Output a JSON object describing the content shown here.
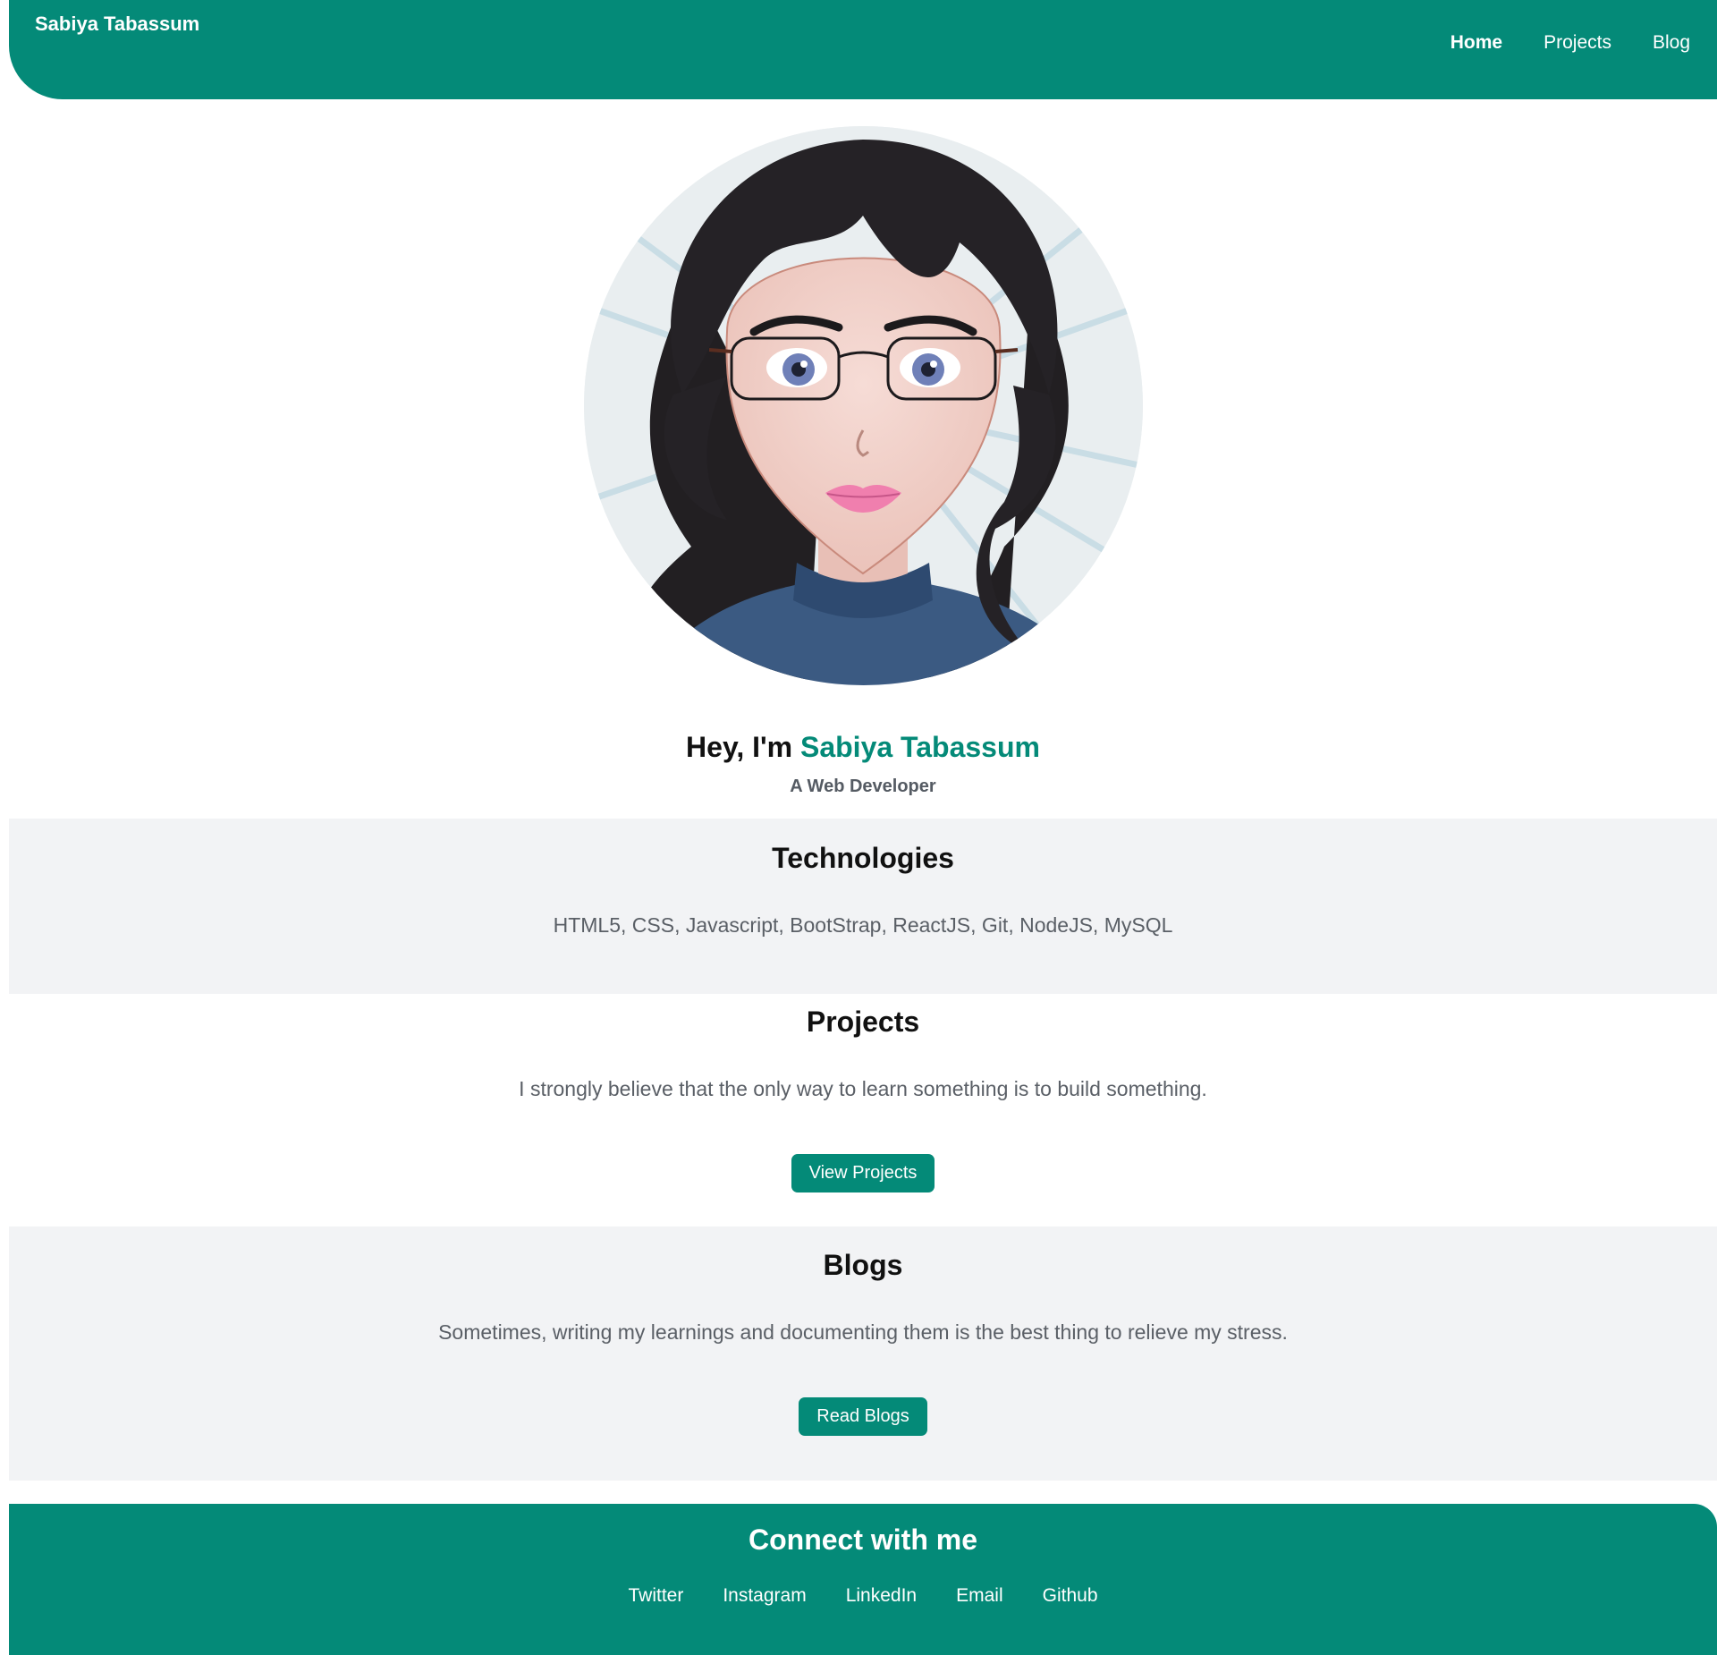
{
  "header": {
    "brand": "Sabiya Tabassum",
    "nav": [
      {
        "label": "Home",
        "active": true
      },
      {
        "label": "Projects",
        "active": false
      },
      {
        "label": "Blog",
        "active": false
      }
    ]
  },
  "hero": {
    "greeting": "Hey, I'm",
    "name": "Sabiya Tabassum",
    "subtitle": "A Web Developer"
  },
  "technologies": {
    "title": "Technologies",
    "text": "HTML5, CSS, Javascript, BootStrap, ReactJS, Git, NodeJS, MySQL"
  },
  "projects": {
    "title": "Projects",
    "text": "I strongly believe that the only way to learn something is to build something.",
    "button": "View Projects"
  },
  "blogs": {
    "title": "Blogs",
    "text": "Sometimes, writing my learnings and documenting them is the best thing to relieve my stress.",
    "button": "Read Blogs"
  },
  "footer": {
    "title": "Connect with me",
    "links": [
      "Twitter",
      "Instagram",
      "LinkedIn",
      "Email",
      "Github"
    ]
  },
  "colors": {
    "accent": "#048a78",
    "section_gray": "#f2f3f5",
    "muted_text": "#5a5f66"
  }
}
